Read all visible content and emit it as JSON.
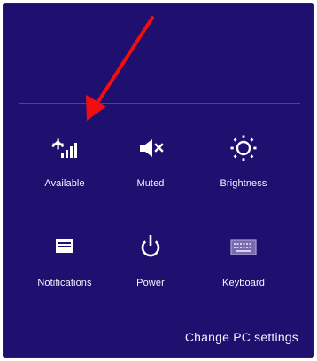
{
  "panel": {
    "background": "#1f0f6e",
    "divider_color": "#5b4a9a",
    "tiles": [
      {
        "label": "Available",
        "icon": "wifi-signal-icon"
      },
      {
        "label": "Muted",
        "icon": "speaker-muted-icon"
      },
      {
        "label": "Brightness",
        "icon": "brightness-icon"
      },
      {
        "label": "Notifications",
        "icon": "notifications-icon"
      },
      {
        "label": "Power",
        "icon": "power-icon"
      },
      {
        "label": "Keyboard",
        "icon": "keyboard-icon"
      }
    ],
    "change_pc_settings": "Change PC settings"
  },
  "annotation": {
    "arrow_color": "#f20e0e",
    "arrow_icon": "red-arrow-icon"
  }
}
